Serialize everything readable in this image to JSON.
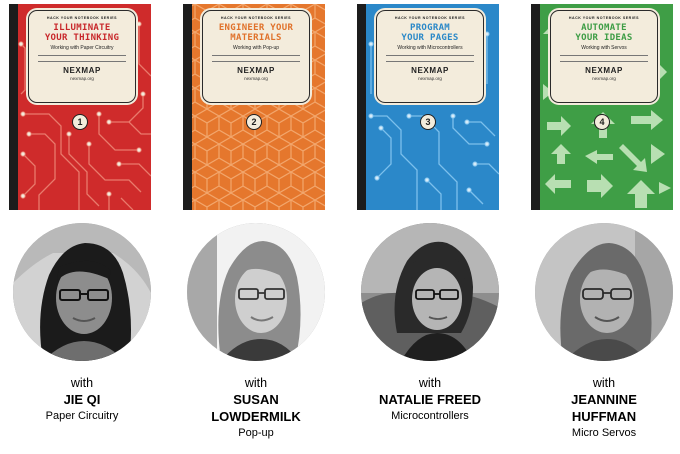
{
  "notebooks": [
    {
      "series": "HACK YOUR NOTEBOOK SERIES",
      "title_lines": [
        "ILLUMINATE",
        "YOUR THINKING"
      ],
      "subtitle": "Working with Paper Circuitry",
      "logo": "NEXMAP",
      "url": "nexmap.org",
      "number": "1",
      "cover_color": "#cf2b2b",
      "title_color": "#c8282b",
      "pattern_name": "circuit-pattern"
    },
    {
      "series": "HACK YOUR NOTEBOOK SERIES",
      "title_lines": [
        "ENGINEER YOUR",
        "MATERIALS"
      ],
      "subtitle": "Working with Pop-up",
      "logo": "NEXMAP",
      "url": "nexmap.org",
      "number": "2",
      "cover_color": "#e5772d",
      "title_color": "#e0712a",
      "pattern_name": "cube-pattern"
    },
    {
      "series": "HACK YOUR NOTEBOOK SERIES",
      "title_lines": [
        "PROGRAM",
        "YOUR PAGES"
      ],
      "subtitle": "Working with Microcontrollers",
      "logo": "NEXMAP",
      "url": "nexmap.org",
      "number": "3",
      "cover_color": "#2b88c9",
      "title_color": "#2a88c8",
      "pattern_name": "trace-pattern"
    },
    {
      "series": "HACK YOUR NOTEBOOK SERIES",
      "title_lines": [
        "AUTOMATE",
        "YOUR IDEAS"
      ],
      "subtitle": "Working with Servos",
      "logo": "NEXMAP",
      "url": "nexmap.org",
      "number": "4",
      "cover_color": "#3f9e46",
      "title_color": "#3c9c44",
      "pattern_name": "arrow-pattern"
    }
  ],
  "people": [
    {
      "with": "with",
      "name_lines": [
        "JIE QI"
      ],
      "topic": "Paper Circuitry"
    },
    {
      "with": "with",
      "name_lines": [
        "SUSAN",
        "LOWDERMILK"
      ],
      "topic": "Pop-up"
    },
    {
      "with": "with",
      "name_lines": [
        "NATALIE FREED"
      ],
      "topic": "Microcontrollers"
    },
    {
      "with": "with",
      "name_lines": [
        "JEANNINE",
        "HUFFMAN"
      ],
      "topic": "Micro Servos"
    }
  ]
}
